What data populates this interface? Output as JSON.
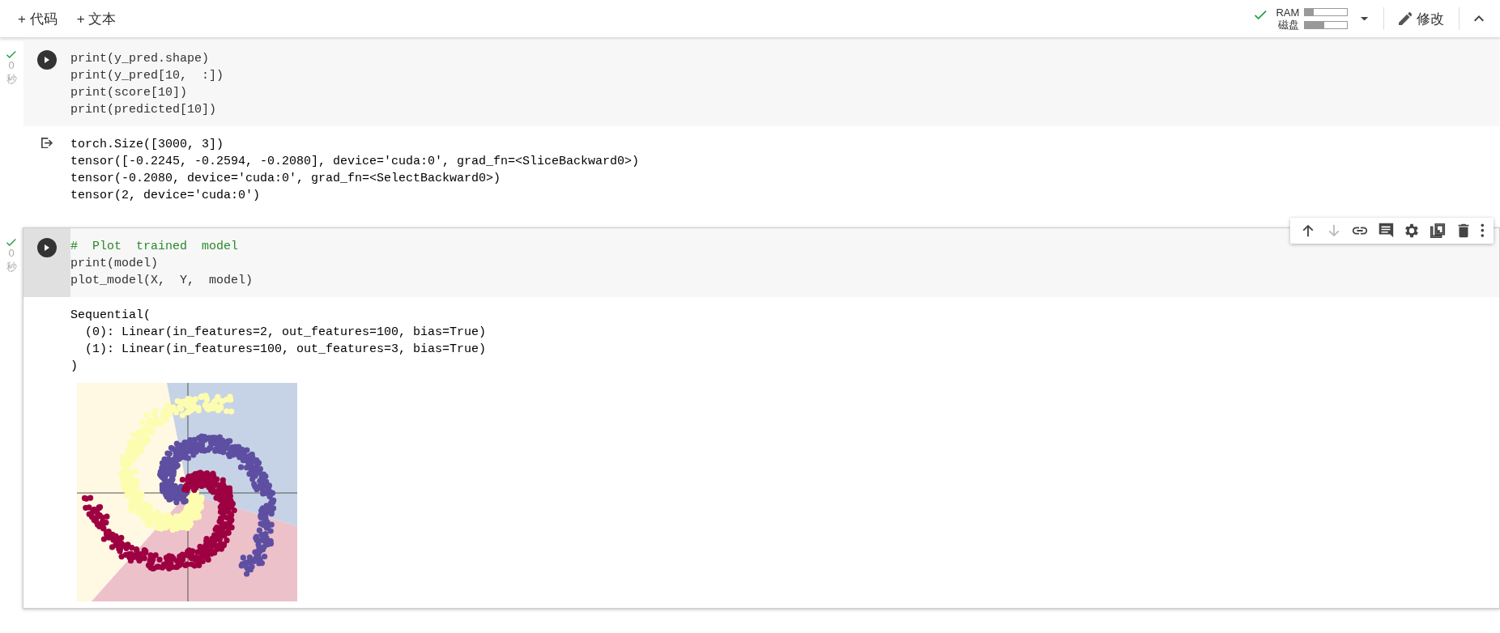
{
  "top_bar": {
    "insert_buttons": [
      {
        "icon": "+",
        "label": "代码"
      },
      {
        "icon": "+",
        "label": "文本"
      }
    ],
    "resources": {
      "connected": true,
      "meters": [
        {
          "label": "RAM",
          "level": 0.2
        },
        {
          "label": "磁盘",
          "level": 0.45
        }
      ]
    },
    "edit_button": {
      "label": "修改"
    }
  },
  "cells": [
    {
      "focused": false,
      "executed": true,
      "time": "0",
      "time_unit": "秒",
      "code": [
        {
          "kind": "code",
          "text": "print(y_pred.shape)"
        },
        {
          "kind": "code",
          "text": "print(y_pred[10,  :])"
        },
        {
          "kind": "code",
          "text": "print(score[10])"
        },
        {
          "kind": "code",
          "text": "print(predicted[10])"
        }
      ],
      "output_icon": true,
      "output": [
        "torch.Size([3000, 3])",
        "tensor([-0.2245, -0.2594, -0.2080], device='cuda:0', grad_fn=<SliceBackward0>)",
        "tensor(-0.2080, device='cuda:0', grad_fn=<SelectBackward0>)",
        "tensor(2, device='cuda:0')"
      ],
      "plot": false
    },
    {
      "focused": true,
      "executed": true,
      "time": "0",
      "time_unit": "秒",
      "code": [
        {
          "kind": "comment",
          "text": "#  Plot  trained  model"
        },
        {
          "kind": "code",
          "text": "print(model)"
        },
        {
          "kind": "code",
          "text": "plot_model(X,  Y,  model)"
        }
      ],
      "output_icon": false,
      "output": [
        "Sequential(",
        "  (0): Linear(in_features=2, out_features=100, bias=True)",
        "  (1): Linear(in_features=100, out_features=3, bias=True)",
        ")"
      ],
      "plot": true,
      "toolbar": [
        {
          "kind": "up",
          "disabled": false
        },
        {
          "kind": "down",
          "disabled": true
        },
        {
          "kind": "link",
          "disabled": false
        },
        {
          "kind": "comment",
          "disabled": false
        },
        {
          "kind": "settings",
          "disabled": false
        },
        {
          "kind": "mirror",
          "disabled": false
        },
        {
          "kind": "delete",
          "disabled": false
        },
        {
          "kind": "more",
          "disabled": false
        }
      ]
    }
  ]
}
